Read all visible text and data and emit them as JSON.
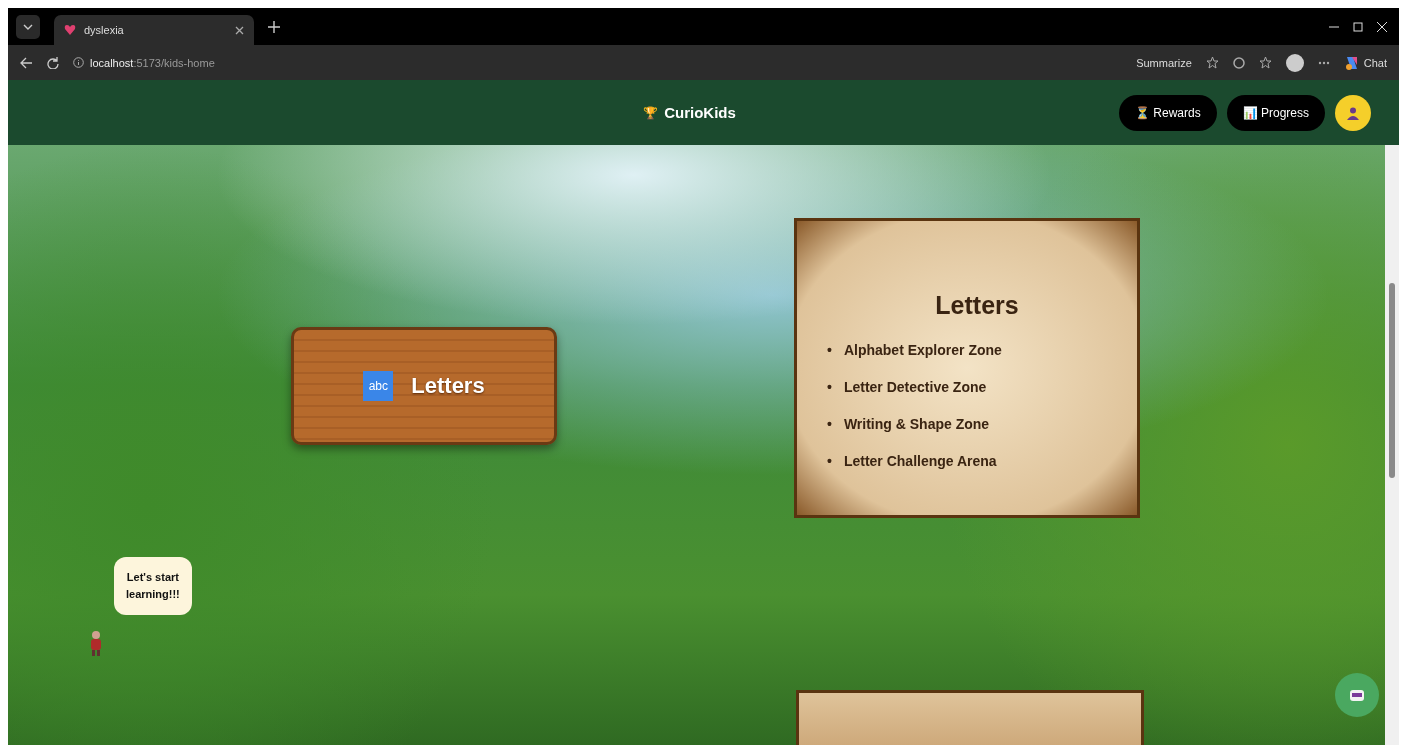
{
  "browser": {
    "tab_title": "dyslexia",
    "url_host": "localhost",
    "url_path": ":5173/kids-home",
    "summarize": "Summarize",
    "chat": "Chat"
  },
  "header": {
    "logo_icon": "🏆",
    "brand": "CurioKids",
    "buttons": [
      {
        "icon": "⏳",
        "label": "Rewards"
      },
      {
        "icon": "📊",
        "label": "Progress"
      }
    ]
  },
  "sign": {
    "badge": "abc",
    "title": "Letters"
  },
  "scroll": {
    "title": "Letters",
    "bullet": "•",
    "items": [
      "Alphabet Explorer Zone",
      "Letter Detective Zone",
      "Writing & Shape Zone",
      "Letter Challenge Arena"
    ]
  },
  "speech_bubble": {
    "lines": [
      "Let's start",
      "learning!!!"
    ]
  }
}
